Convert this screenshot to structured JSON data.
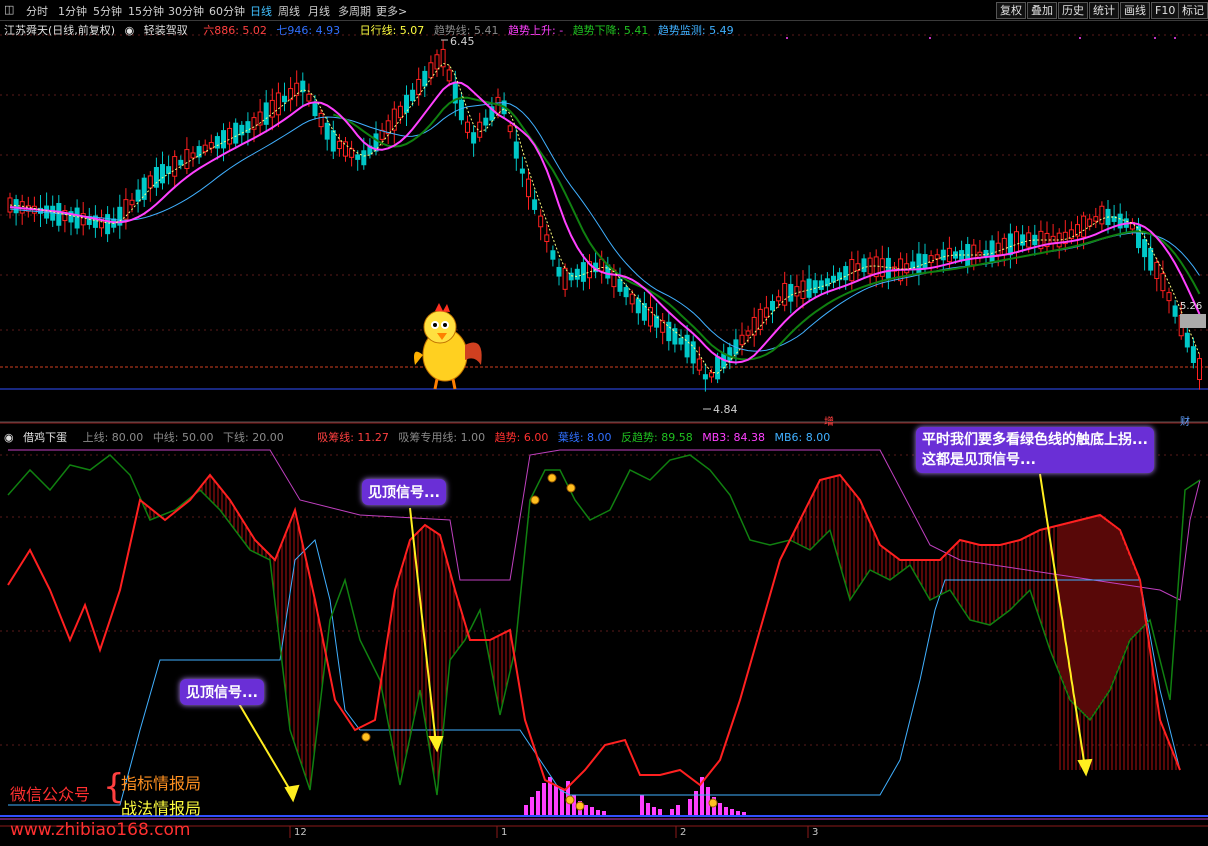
{
  "toolbar": {
    "menu_icon": "menu-square-icon",
    "tabs": [
      "分时",
      "1分钟",
      "5分钟",
      "15分钟",
      "30分钟",
      "60分钟",
      "日线",
      "周线",
      "月线",
      "多周期",
      "更多>"
    ],
    "active_tab": "日线",
    "right_buttons": [
      "复权",
      "叠加",
      "历史",
      "统计",
      "画线",
      "F10",
      "标记"
    ]
  },
  "main_chart": {
    "stock_name": "江苏舜天(日线,前复权)",
    "indicator_name": "轻装驾驭",
    "legend": [
      {
        "label": "六886: 5.02",
        "color": "#ff4040"
      },
      {
        "label": "七946: 4.93",
        "color": "#3070ff"
      },
      {
        "label": "日行线: 5.07",
        "color": "#ffff40"
      },
      {
        "label": "趋势线: 5.41",
        "color": "#8a8a8a"
      },
      {
        "label": "趋势上升: -",
        "color": "#ff40ff"
      },
      {
        "label": "趋势下降: 5.41",
        "color": "#20c020"
      },
      {
        "label": "趋势监测: 5.49",
        "color": "#40b0ff"
      }
    ],
    "high_label": "6.45",
    "low_label": "4.84",
    "price_tag": "5.26",
    "markers": [
      {
        "text": "增",
        "color": "#ff4040"
      },
      {
        "text": "财",
        "color": "#60a0ff"
      }
    ]
  },
  "sub_chart": {
    "indicator_name": "借鸡下蛋",
    "legend": [
      {
        "label": "上线: 80.00",
        "color": "#8a8a8a"
      },
      {
        "label": "中线: 50.00",
        "color": "#8a8a8a"
      },
      {
        "label": "下线: 20.00",
        "color": "#8a8a8a"
      },
      {
        "label": "吸筹线: 11.27",
        "color": "#ff4040"
      },
      {
        "label": "吸筹专用线: 1.00",
        "color": "#8a8a8a"
      },
      {
        "label": "趋势: 6.00",
        "color": "#ff3030"
      },
      {
        "label": "葉线: 8.00",
        "color": "#3070ff"
      },
      {
        "label": "反趋势: 89.58",
        "color": "#20c020"
      },
      {
        "label": "MB3: 84.38",
        "color": "#ff40ff"
      },
      {
        "label": "MB6: 8.00",
        "color": "#40b0ff"
      }
    ]
  },
  "callouts": {
    "top_signal_1": "见顶信号...",
    "top_signal_2": "见顶信号...",
    "advice_line1": "平时我们要多看绿色线的触底上拐...",
    "advice_line2": "这都是见顶信号..."
  },
  "watermark": {
    "wechat": "微信公众号",
    "brace": "{",
    "line1": "指标情报局",
    "line2": "战法情报局",
    "site": "www.zhibiao168.com"
  },
  "time_axis": [
    "12",
    "1",
    "2",
    "3"
  ],
  "colors": {
    "up": "#ff2020",
    "down": "#00c8c8",
    "ma_magenta": "#ff40ff",
    "ma_green": "#108010",
    "ma_blue": "#40b0ff",
    "callout_bg": "#6a2fd6"
  }
}
